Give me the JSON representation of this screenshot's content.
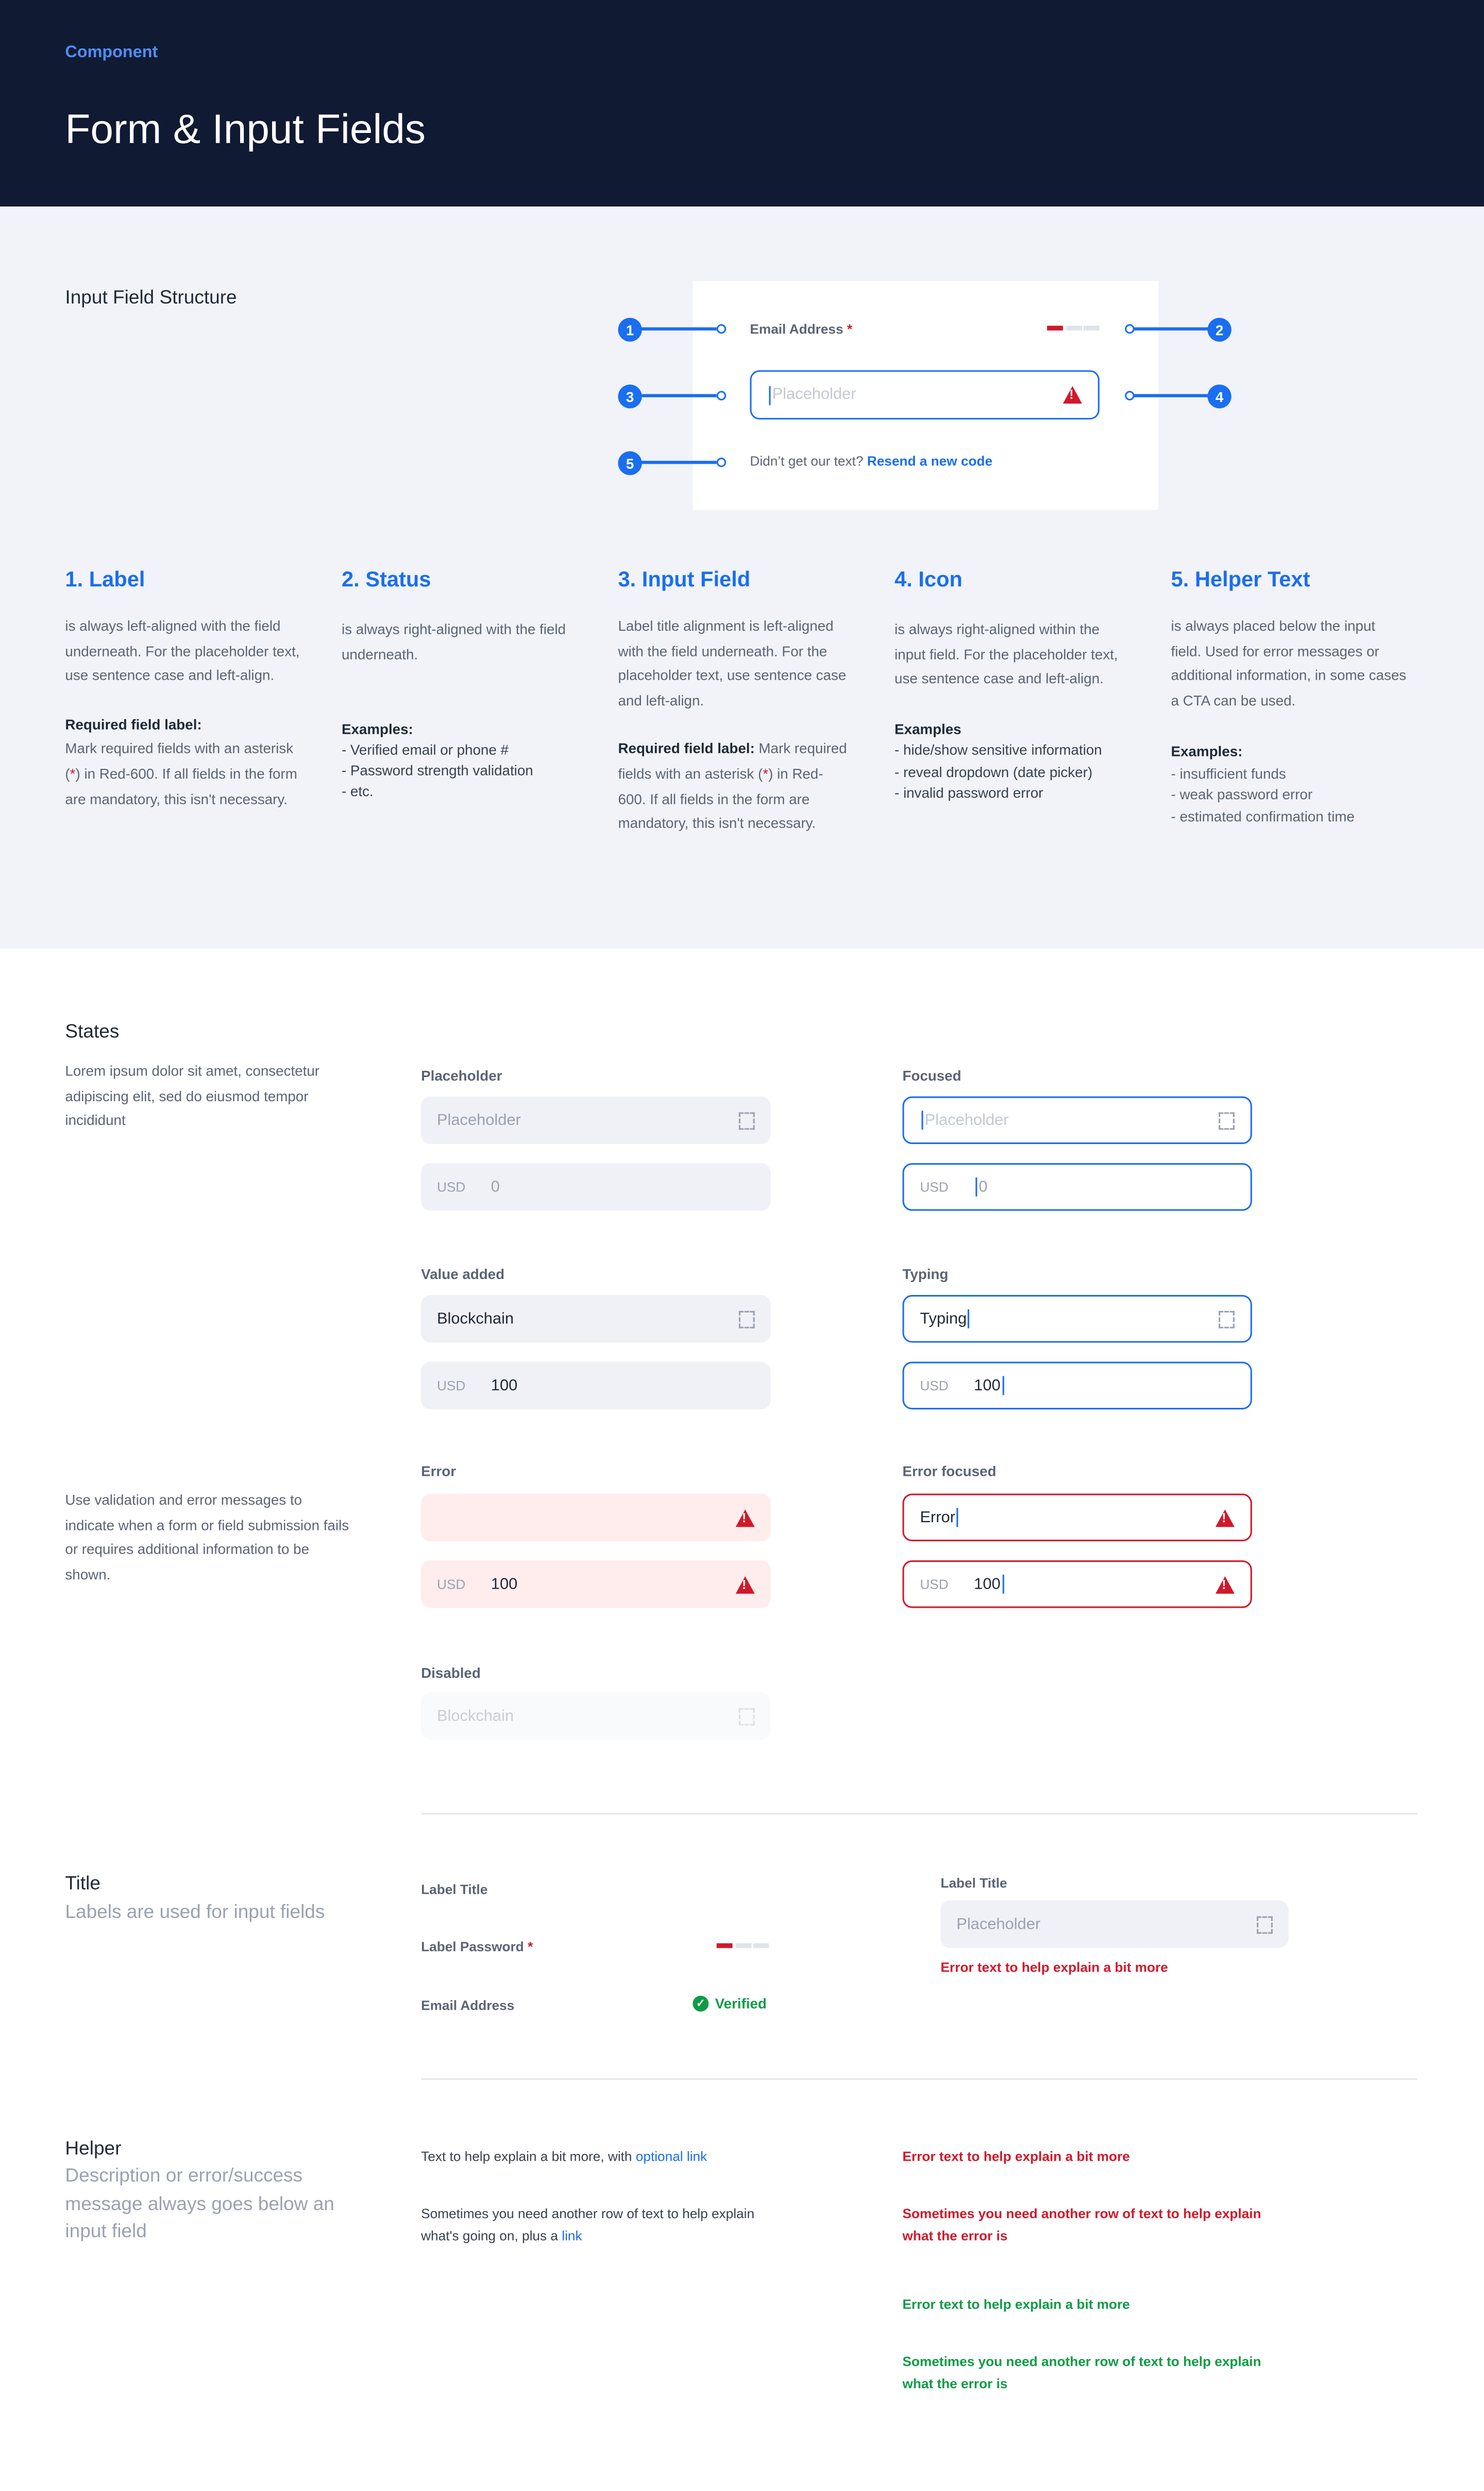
{
  "header": {
    "eyebrow": "Component",
    "title": "Form & Input Fields"
  },
  "colors": {
    "header_bg": "#111a33",
    "accent": "#1a6ef0",
    "error": "#d0192b",
    "success": "#0f9b47",
    "section_bg": "#f1f3f8"
  },
  "structure": {
    "title": "Input Field Structure",
    "markers": [
      "1",
      "2",
      "3",
      "4",
      "5"
    ],
    "label": "Email Address",
    "required": "*",
    "strength_level": "1/3",
    "placeholder": "Placeholder",
    "icon": "warning-triangle-icon",
    "helper": "Didn’t get our text?",
    "helper_link": "Resend a new code"
  },
  "columns": [
    {
      "heading": "1. Label",
      "text": "is always left-aligned with the field underneath. For the placeholder text, use sentence case and left-align.",
      "sub_title": "Required field label:",
      "sub_pre": "Mark required fields with an asterisk (",
      "sub_star": "*",
      "sub_post": ") in Red-600. If all fields in the form are mandatory, this isn't necessary."
    },
    {
      "heading": "2. Status",
      "text": "is always right-aligned with the field underneath.",
      "examples_title": "Examples:",
      "examples": [
        "- Verified email or phone #",
        "- Password strength validation",
        "- etc."
      ]
    },
    {
      "heading": "3. Input Field",
      "text": "Label title alignment is left-aligned with the field underneath. For the placeholder text, use sentence case and left-align.",
      "sub_title": "Required field label:",
      "sub_pre": " Mark required fields with an asterisk (",
      "sub_star": "*",
      "sub_post": ") in Red-600. If all fields in the form are mandatory, this isn't necessary."
    },
    {
      "heading": "4. Icon",
      "text": "is always right-aligned within the input field. For the placeholder text, use sentence case and left-align.",
      "examples_title": "Examples",
      "examples": [
        "- hide/show sensitive information",
        "- reveal dropdown (date picker)",
        "- invalid password error"
      ]
    },
    {
      "heading": "5. Helper Text",
      "text": "is always placed below the input field. Used for error messages or additional information, in some cases a CTA can be used.",
      "examples_title": "Examples:",
      "examples": [
        "- insufficient funds",
        "- weak password error",
        "- estimated confirmation time"
      ]
    }
  ],
  "states": {
    "title": "States",
    "desc": "Lorem ipsum dolor sit amet, consectetur adipiscing elit, sed do eiusmod tempor incididunt",
    "error_desc": "Use validation and error messages to indicate when a form or field submission fails or requires additional information to be shown.",
    "currency": "USD",
    "placeholder": {
      "label": "Placeholder",
      "text": "Placeholder",
      "amount": "0"
    },
    "focused": {
      "label": "Focused",
      "text": "Placeholder",
      "amount": "0"
    },
    "value_added": {
      "label": "Value added",
      "text": "Blockchain",
      "amount": "100"
    },
    "typing": {
      "label": "Typing",
      "text": "Typing",
      "amount": "100"
    },
    "error": {
      "label": "Error",
      "amount": "100"
    },
    "error_focused": {
      "label": "Error focused",
      "text": "Error",
      "amount": "100"
    },
    "disabled": {
      "label": "Disabled",
      "text": "Blockchain"
    }
  },
  "title_section": {
    "title": "Title",
    "subtitle": "Labels are used for input fields",
    "label_title": "Label Title",
    "label_password": "Label Password",
    "required": "*",
    "strength_level": "1/3",
    "email": "Email Address",
    "verified": "Verified",
    "example_label": "Label Title",
    "example_placeholder": "Placeholder",
    "example_error": "Error text to help explain a bit more"
  },
  "helper_section": {
    "title": "Helper",
    "subtitle": "Description or error/success message always goes below an input field",
    "h1": "Text to help explain a bit more, with ",
    "h1_link": "optional link",
    "h2": "Sometimes you need another row of text to help explain what's going on, plus a ",
    "h2_link": "link",
    "e1": "Error text to help explain a bit more",
    "e2": "Sometimes you need another row of text to help explain what the error is",
    "s1": "Error text to help explain a bit more",
    "s2": "Sometimes you need another row of text to help explain what the error is"
  }
}
